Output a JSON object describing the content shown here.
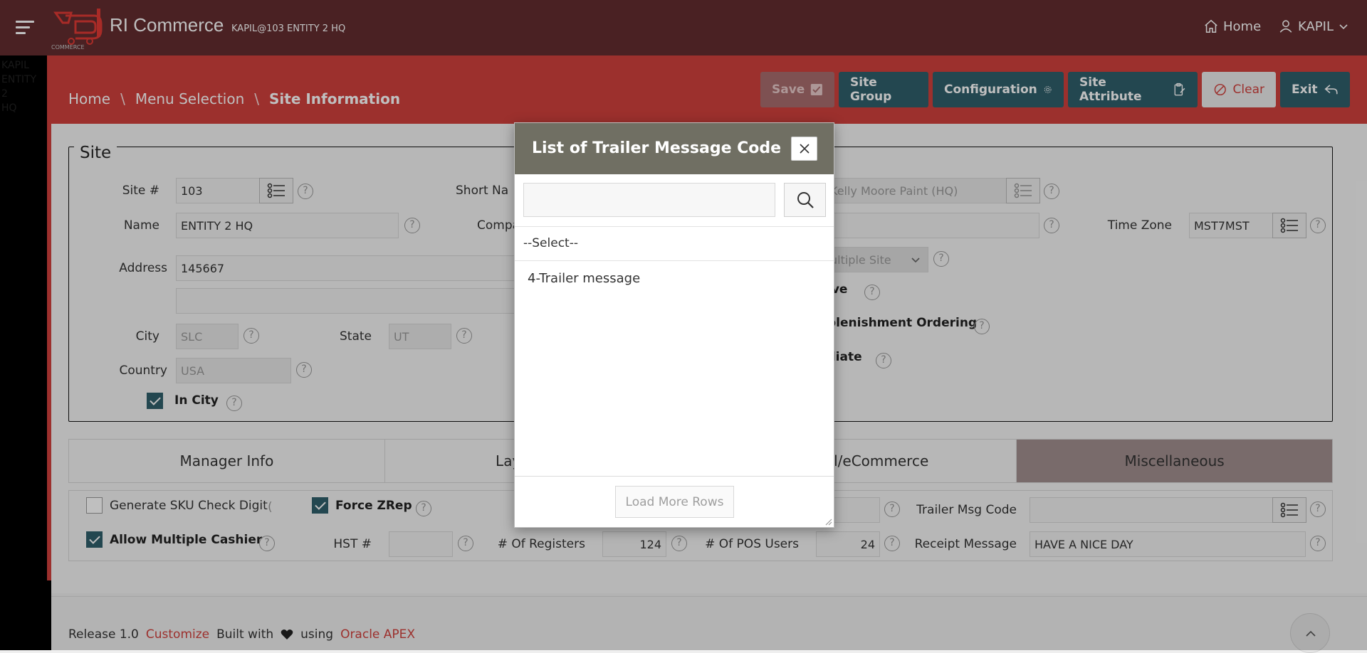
{
  "header": {
    "app_title": "RI Commerce",
    "app_subtitle": "KAPIL@103 ENTITY 2 HQ",
    "logo_text": "COMMERCE",
    "home_label": "Home",
    "user_label": "KAPIL",
    "icons": {
      "menu": "hamburger-icon",
      "home": "home-icon",
      "user": "user-icon",
      "dropdown": "chevron-down-icon"
    }
  },
  "left_strip_text": [
    "KAPIL",
    "ENTITY",
    "2",
    "HQ"
  ],
  "breadcrumb": {
    "home": "Home",
    "menu": "Menu Selection",
    "current": "Site Information"
  },
  "toolbar": {
    "save": "Save",
    "site_group": "Site Group",
    "configuration": "Configuration",
    "site_attribute": "Site Attribute",
    "clear": "Clear",
    "exit": "Exit"
  },
  "site": {
    "legend": "Site",
    "site_no_label": "Site #",
    "site_no_value": "103",
    "short_name_label": "Short Na",
    "company_parent_value": "Kelly Moore Paint (HQ)",
    "name_label": "Name",
    "name_value": "ENTITY 2 HQ",
    "company_label": "Compa",
    "time_zone_label": "Time Zone",
    "time_zone_value": "MST7MST",
    "address_label": "Address",
    "address_value": "145667",
    "address2_value": "",
    "multiple_site_value": "ultiple Site",
    "active_label": "ive",
    "replenishment_label": "plenishment Ordering",
    "affiliate_label": "iliate",
    "city_label": "City",
    "city_value": "SLC",
    "state_label": "State",
    "state_value": "UT",
    "country_label": "Country",
    "country_value": "USA",
    "in_city_label": "In City",
    "in_city_checked": true
  },
  "tabs": [
    {
      "label": "Manager Info",
      "active": false
    },
    {
      "label": "Layaway Info",
      "active": false
    },
    {
      "label": "Journal/eCommerce",
      "active": false
    },
    {
      "label": "Miscellaneous",
      "active": true
    }
  ],
  "misc": {
    "gen_sku_label": "Generate SKU Check Digit",
    "gen_sku_checked": false,
    "force_zrep_label": "Force ZRep",
    "force_zrep_checked": true,
    "allow_multi_cashier_label": "Allow Multiple Cashier",
    "allow_multi_cashier_checked": true,
    "hst_label": "HST #",
    "hst_value": "",
    "registers_label": "# Of Registers",
    "registers_value": "124",
    "pos_users_label": "# Of POS Users",
    "pos_users_value": "24",
    "trailer_msg_label": "Trailer Msg Code",
    "trailer_msg_value": "",
    "receipt_msg_label": "Receipt Message",
    "receipt_msg_value": "HAVE A NICE DAY"
  },
  "footer": {
    "release": "Release 1.0",
    "customize": "Customize",
    "built_with": "Built with",
    "using": "using",
    "apex": "Oracle APEX"
  },
  "dialog": {
    "title": "List of Trailer Message Code",
    "search_value": "",
    "select_option": "--Select--",
    "items": [
      "4-Trailer message"
    ],
    "load_more": "Load More Rows"
  },
  "colors": {
    "header_bg": "#632d2f",
    "titlebar_bg": "#d1403c",
    "button_teal": "#2f5f6b",
    "dialog_header": "#706f63",
    "active_tab": "#a28f8f"
  }
}
